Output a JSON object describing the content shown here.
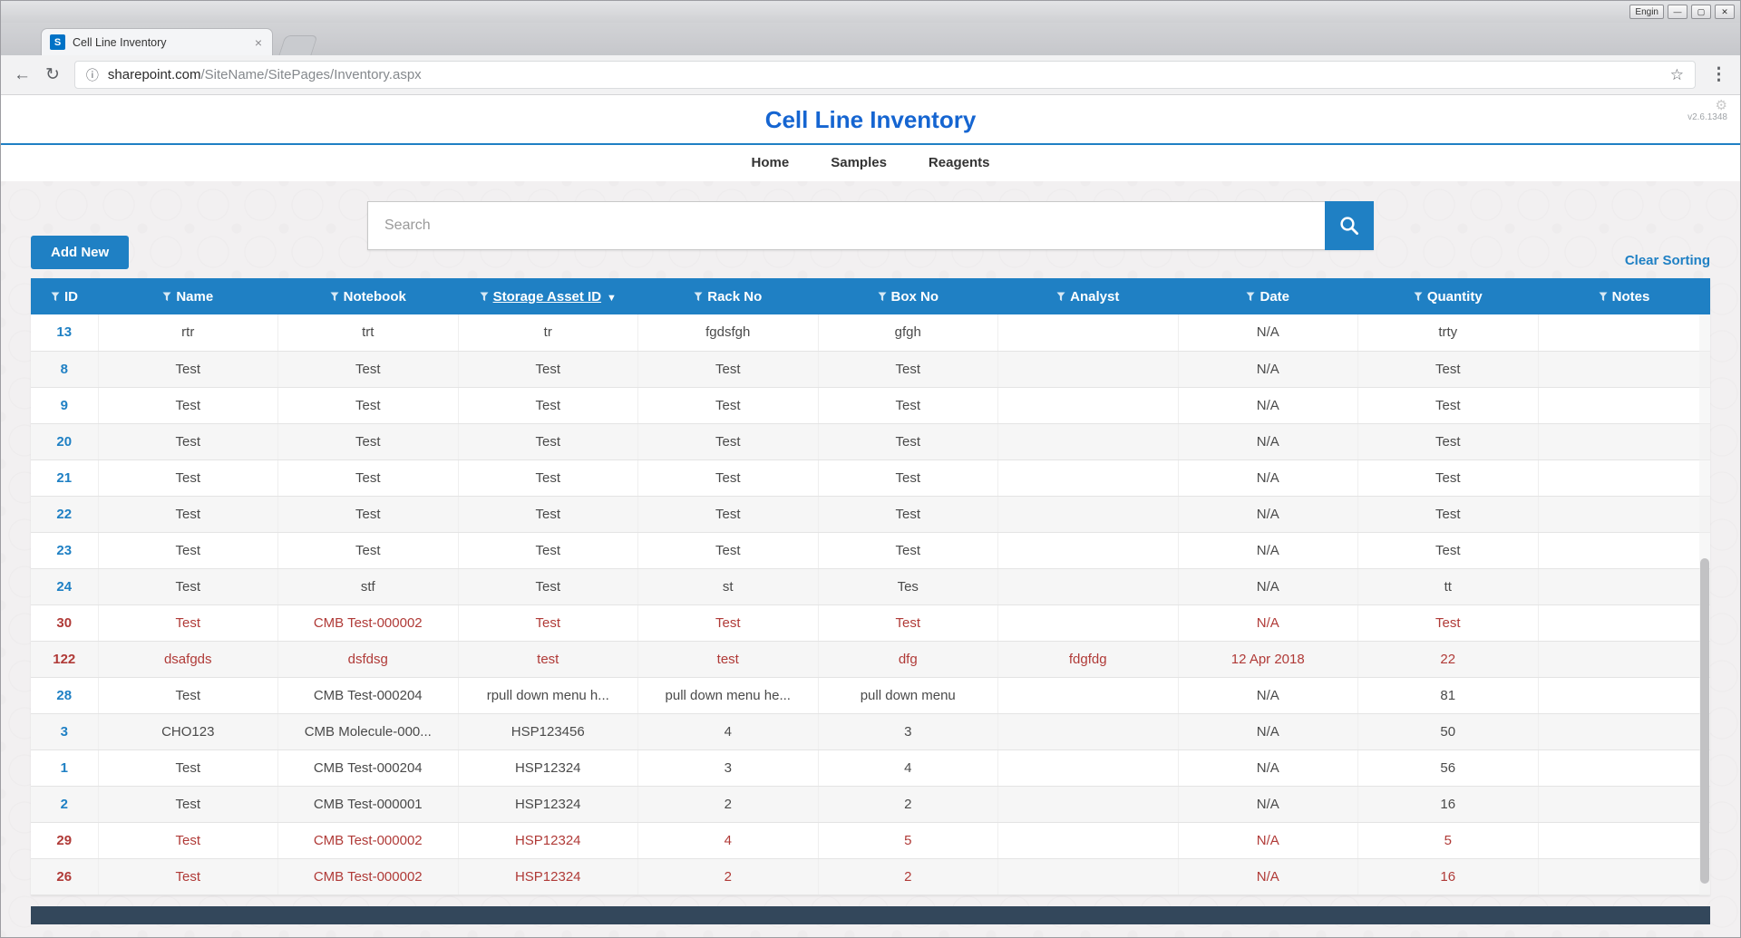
{
  "colors": {
    "accent": "#1f80c4",
    "header-blue": "#1f80c4",
    "title-blue": "#1565d1",
    "red": "#b03a37"
  },
  "icons": {
    "minimize": "—",
    "maximize": "▢",
    "close": "✕",
    "back": "←",
    "refresh": "↻",
    "star": "☆",
    "menu": "⋮",
    "info": "ⓘ",
    "gear": "⚙",
    "tab_close": "×"
  },
  "browser": {
    "tab_title": "Cell Line Inventory",
    "favicon_text": "S",
    "url_domain": "sharepoint.com",
    "url_path": "/SiteName/SitePages/Inventory.aspx",
    "language_label": "Engin"
  },
  "header": {
    "title": "Cell Line Inventory",
    "version": "v2.6.1348",
    "nav": [
      {
        "label": "Home"
      },
      {
        "label": "Samples"
      },
      {
        "label": "Reagents"
      }
    ]
  },
  "controls": {
    "search_placeholder": "Search",
    "add_new_label": "Add New",
    "clear_sorting_label": "Clear Sorting"
  },
  "table": {
    "sort_arrow": "▼",
    "fields": [
      "id",
      "name",
      "notebook",
      "storage_asset_id",
      "rack_no",
      "box_no",
      "analyst",
      "date",
      "quantity",
      "notes"
    ],
    "columns": [
      {
        "label": "ID",
        "sorted": false
      },
      {
        "label": "Name",
        "sorted": false
      },
      {
        "label": "Notebook",
        "sorted": false
      },
      {
        "label": "Storage Asset ID",
        "sorted": true
      },
      {
        "label": "Rack No",
        "sorted": false
      },
      {
        "label": "Box No",
        "sorted": false
      },
      {
        "label": "Analyst",
        "sorted": false
      },
      {
        "label": "Date",
        "sorted": false
      },
      {
        "label": "Quantity",
        "sorted": false
      },
      {
        "label": "Notes",
        "sorted": false
      }
    ],
    "rows": [
      {
        "id": "13",
        "name": "rtr",
        "notebook": "trt",
        "storage_asset_id": "tr",
        "rack_no": "fgdsfgh",
        "box_no": "gfgh",
        "analyst": "",
        "date": "N/A",
        "quantity": "trty",
        "notes": "",
        "highlight": false
      },
      {
        "id": "8",
        "name": "Test",
        "notebook": "Test",
        "storage_asset_id": "Test",
        "rack_no": "Test",
        "box_no": "Test",
        "analyst": "",
        "date": "N/A",
        "quantity": "Test",
        "notes": "",
        "highlight": false
      },
      {
        "id": "9",
        "name": "Test",
        "notebook": "Test",
        "storage_asset_id": "Test",
        "rack_no": "Test",
        "box_no": "Test",
        "analyst": "",
        "date": "N/A",
        "quantity": "Test",
        "notes": "",
        "highlight": false
      },
      {
        "id": "20",
        "name": "Test",
        "notebook": "Test",
        "storage_asset_id": "Test",
        "rack_no": "Test",
        "box_no": "Test",
        "analyst": "",
        "date": "N/A",
        "quantity": "Test",
        "notes": "",
        "highlight": false
      },
      {
        "id": "21",
        "name": "Test",
        "notebook": "Test",
        "storage_asset_id": "Test",
        "rack_no": "Test",
        "box_no": "Test",
        "analyst": "",
        "date": "N/A",
        "quantity": "Test",
        "notes": "",
        "highlight": false
      },
      {
        "id": "22",
        "name": "Test",
        "notebook": "Test",
        "storage_asset_id": "Test",
        "rack_no": "Test",
        "box_no": "Test",
        "analyst": "",
        "date": "N/A",
        "quantity": "Test",
        "notes": "",
        "highlight": false
      },
      {
        "id": "23",
        "name": "Test",
        "notebook": "Test",
        "storage_asset_id": "Test",
        "rack_no": "Test",
        "box_no": "Test",
        "analyst": "",
        "date": "N/A",
        "quantity": "Test",
        "notes": "",
        "highlight": false
      },
      {
        "id": "24",
        "name": "Test",
        "notebook": "stf",
        "storage_asset_id": "Test",
        "rack_no": "st",
        "box_no": "Tes",
        "analyst": "",
        "date": "N/A",
        "quantity": "tt",
        "notes": "",
        "highlight": false
      },
      {
        "id": "30",
        "name": "Test",
        "notebook": "CMB Test-000002",
        "storage_asset_id": "Test",
        "rack_no": "Test",
        "box_no": "Test",
        "analyst": "",
        "date": "N/A",
        "quantity": "Test",
        "notes": "",
        "highlight": true
      },
      {
        "id": "122",
        "name": "dsafgds",
        "notebook": "dsfdsg",
        "storage_asset_id": "test",
        "rack_no": "test",
        "box_no": "dfg",
        "analyst": "fdgfdg",
        "date": "12 Apr 2018",
        "quantity": "22",
        "notes": "",
        "highlight": true
      },
      {
        "id": "28",
        "name": "Test",
        "notebook": "CMB Test-000204",
        "storage_asset_id": "rpull down menu h...",
        "rack_no": "pull down menu he...",
        "box_no": "pull down menu",
        "analyst": "",
        "date": "N/A",
        "quantity": "81",
        "notes": "",
        "highlight": false
      },
      {
        "id": "3",
        "name": "CHO123",
        "notebook": "CMB Molecule-000...",
        "storage_asset_id": "HSP123456",
        "rack_no": "4",
        "box_no": "3",
        "analyst": "",
        "date": "N/A",
        "quantity": "50",
        "notes": "",
        "highlight": false
      },
      {
        "id": "1",
        "name": "Test",
        "notebook": "CMB Test-000204",
        "storage_asset_id": "HSP12324",
        "rack_no": "3",
        "box_no": "4",
        "analyst": "",
        "date": "N/A",
        "quantity": "56",
        "notes": "",
        "highlight": false
      },
      {
        "id": "2",
        "name": "Test",
        "notebook": "CMB Test-000001",
        "storage_asset_id": "HSP12324",
        "rack_no": "2",
        "box_no": "2",
        "analyst": "",
        "date": "N/A",
        "quantity": "16",
        "notes": "",
        "highlight": false
      },
      {
        "id": "29",
        "name": "Test",
        "notebook": "CMB Test-000002",
        "storage_asset_id": "HSP12324",
        "rack_no": "4",
        "box_no": "5",
        "analyst": "",
        "date": "N/A",
        "quantity": "5",
        "notes": "",
        "highlight": true
      },
      {
        "id": "26",
        "name": "Test",
        "notebook": "CMB Test-000002",
        "storage_asset_id": "HSP12324",
        "rack_no": "2",
        "box_no": "2",
        "analyst": "",
        "date": "N/A",
        "quantity": "16",
        "notes": "",
        "highlight": true
      }
    ]
  }
}
